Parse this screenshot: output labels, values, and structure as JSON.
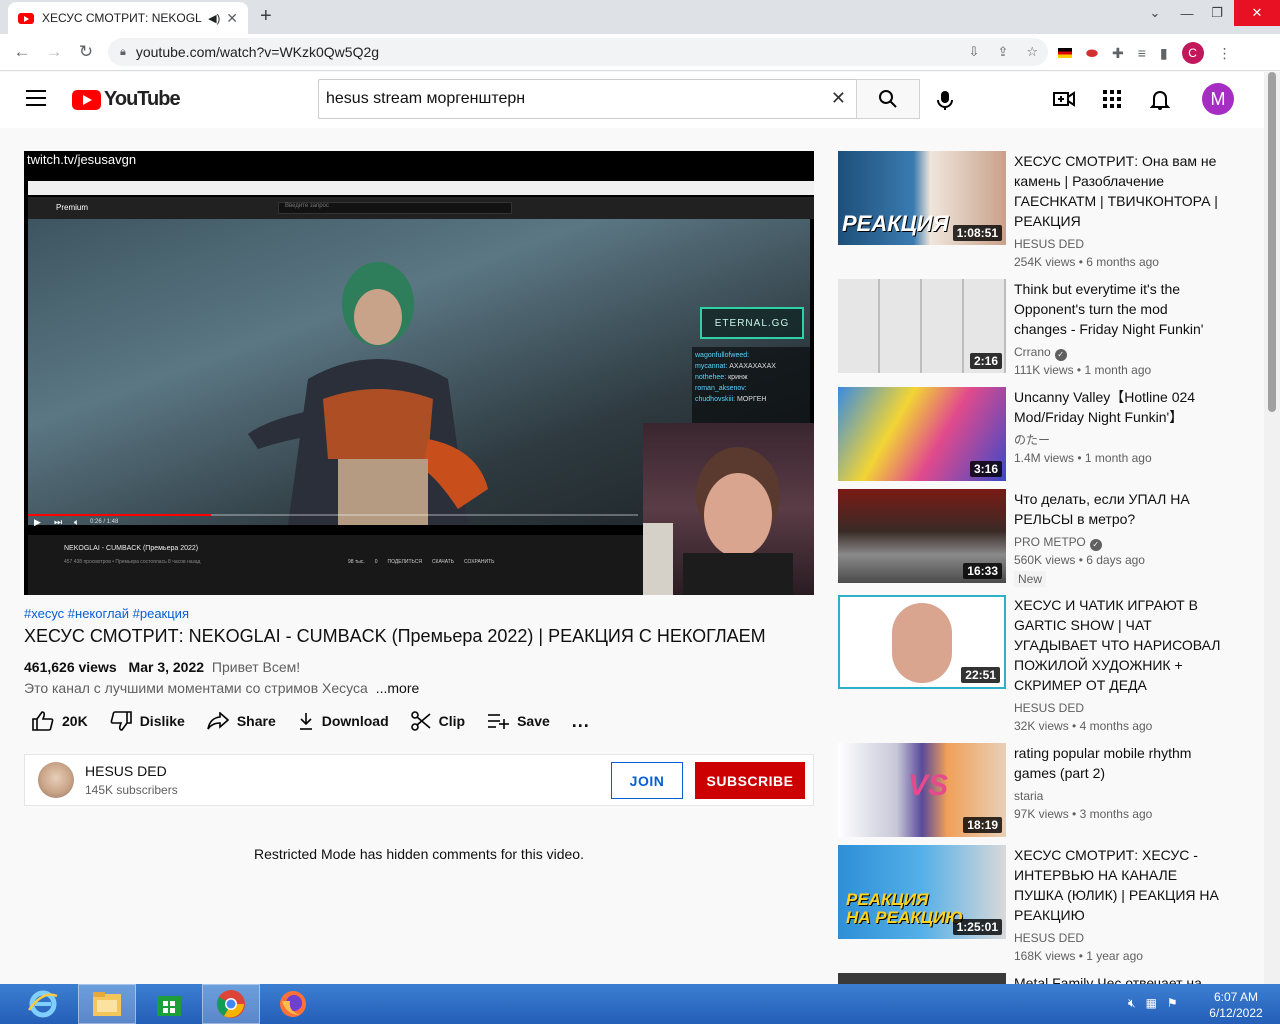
{
  "browser": {
    "tab_title": "ХЕСУС СМОТРИТ: NEKOGLAI - CUMBACK",
    "new_tab": "+",
    "url": "youtube.com/watch?v=WKzk0Qw5Q2g",
    "profile_initial": "C"
  },
  "youtube": {
    "logo_text": "YouTube",
    "search_value": "hesus stream моргенштерн",
    "avatar_initial": "M",
    "accent": "#ff0000"
  },
  "player": {
    "url_overlay": "twitch.tv/jesusavgn",
    "inner_logo": "Premium",
    "inner_search_placeholder": "Введите запрос",
    "overlay_brand": "ETERNAL.GG",
    "chat": [
      {
        "user": "wagonfullofweed:",
        "text": ""
      },
      {
        "user": "mycannat:",
        "text": "АХАХАХАХАХ"
      },
      {
        "user": "nothehee:",
        "text": "кринж"
      },
      {
        "user": "roman_aksenov:",
        "text": ""
      },
      {
        "user": "chudhovskiii:",
        "text": "МОРГЕН"
      }
    ],
    "inner_time": "0:26 / 1:48",
    "inner_title": "NEKOGLAI - CUMBACK (Премьера 2022)",
    "inner_meta": "457 438 просмотров • Премьера состоялась 8 часов назад",
    "inner_actions": [
      "98 тыс.",
      "0",
      "ПОДЕЛИТЬСЯ",
      "СКАЧАТЬ",
      "СОХРАНИТЬ"
    ],
    "progress": 0.3
  },
  "video": {
    "hashtags": "#хесус #некоглай #реакция",
    "title": "ХЕСУС СМОТРИТ: NEKOGLAI - CUMBACK (Премьера 2022) | РЕАКЦИЯ С НЕКОГЛАЕМ",
    "views": "461,626 views",
    "date": "Mar 3, 2022",
    "desc_first": "Привет Всем!",
    "desc_second": "Это канал с лучшими моментами со стримов Хесуса",
    "more": "...more",
    "likes": "20K",
    "dislike": "Dislike",
    "share": "Share",
    "download": "Download",
    "clip": "Clip",
    "save": "Save",
    "more_actions": "..."
  },
  "channel": {
    "name": "HESUS DED",
    "subscribers": "145K subscribers",
    "join": "JOIN",
    "subscribe": "SUBSCRIBE"
  },
  "comments_notice": "Restricted Mode has hidden comments for this video.",
  "recommendations": [
    {
      "title": "ХЕСУС СМОТРИТ: Она вам не камень | Разоблачение ГАЕСНКАТМ | ТВИЧКОНТОРА | РЕАКЦИЯ",
      "channel": "HESUS DED",
      "views": "254K views",
      "age": "6 months ago",
      "duration": "1:08:51",
      "verified": false,
      "badge": ""
    },
    {
      "title": "Think but everytime it's the Opponent's turn the mod changes - Friday Night Funkin'",
      "channel": "Crrano",
      "views": "111K views",
      "age": "1 month ago",
      "duration": "2:16",
      "verified": true,
      "badge": ""
    },
    {
      "title": "Uncanny Valley【Hotline 024 Mod/Friday Night Funkin'】",
      "channel": "のたー",
      "views": "1.4M views",
      "age": "1 month ago",
      "duration": "3:16",
      "verified": false,
      "badge": ""
    },
    {
      "title": "Что делать, если УПАЛ НА РЕЛЬСЫ в метро?",
      "channel": "PRO МЕТРО",
      "views": "560K views",
      "age": "6 days ago",
      "duration": "16:33",
      "verified": true,
      "badge": "New"
    },
    {
      "title": "ХЕСУС И ЧАТИК ИГРАЮТ В GARTIC SHOW | ЧАТ УГАДЫВАЕТ ЧТО НАРИСОВАЛ ПОЖИЛОЙ ХУДОЖНИК + СКРИМЕР ОТ ДЕДА",
      "channel": "HESUS DED",
      "views": "32K views",
      "age": "4 months ago",
      "duration": "22:51",
      "verified": false,
      "badge": ""
    },
    {
      "title": "rating popular mobile rhythm games (part 2)",
      "channel": "staria",
      "views": "97K views",
      "age": "3 months ago",
      "duration": "18:19",
      "verified": false,
      "badge": ""
    },
    {
      "title": "ХЕСУС СМОТРИТ: ХЕСУС - ИНТЕРВЬЮ НА КАНАЛЕ ПУШКА (ЮЛИК) | РЕАКЦИЯ НА РЕАКЦИЮ",
      "channel": "HESUS DED",
      "views": "168K views",
      "age": "1 year ago",
      "duration": "1:25:01",
      "verified": false,
      "badge": ""
    },
    {
      "title": "Metal Family Чес отвечает на",
      "channel": "",
      "views": "",
      "age": "",
      "duration": "",
      "verified": false,
      "badge": ""
    }
  ],
  "taskbar": {
    "time": "6:07 AM",
    "date": "6/12/2022"
  }
}
